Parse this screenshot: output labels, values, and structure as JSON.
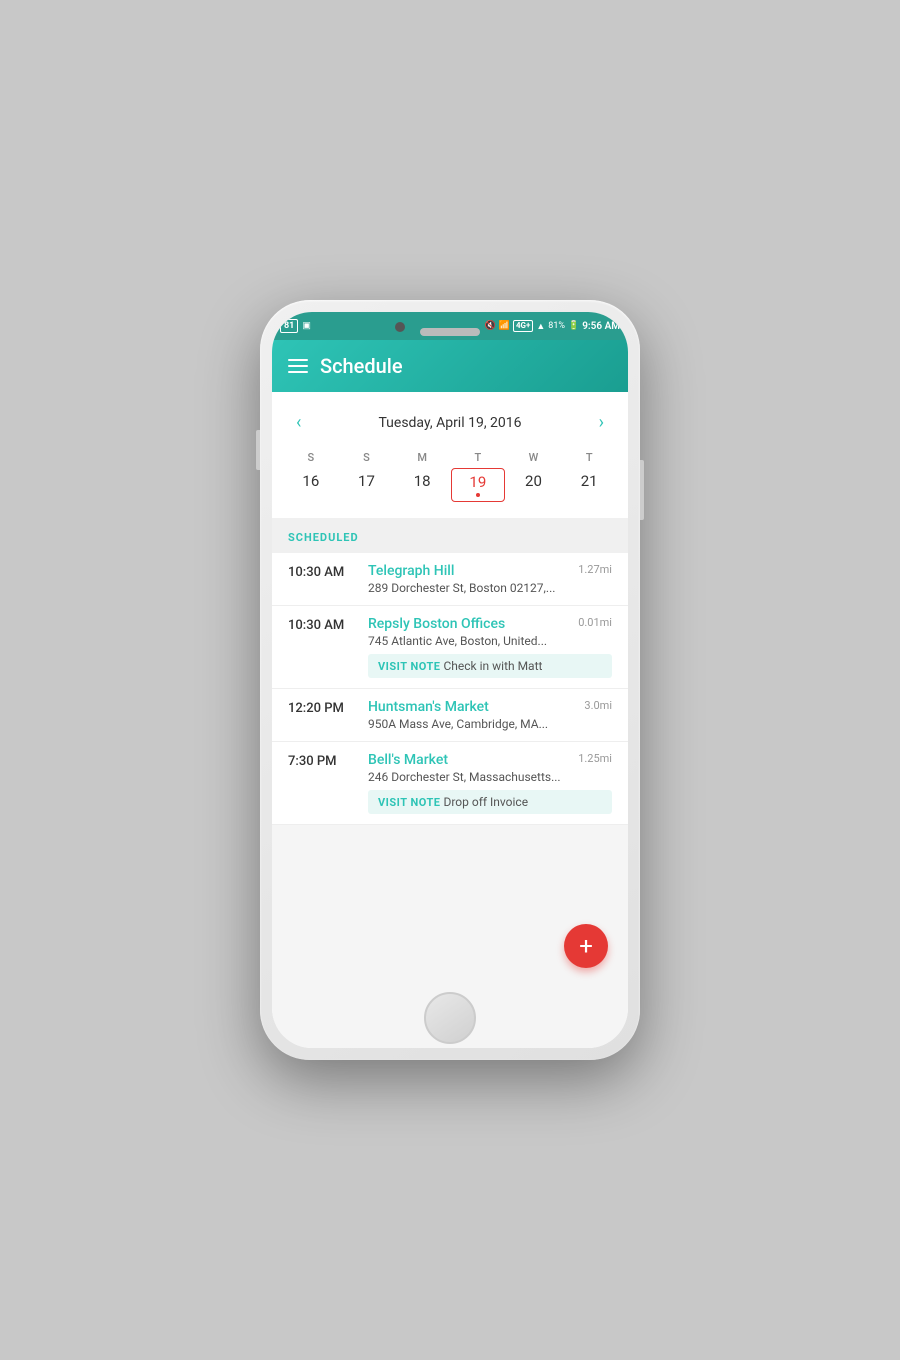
{
  "status_bar": {
    "badge1": "81",
    "time": "9:56 AM",
    "battery": "81%",
    "lte": "4G+"
  },
  "app_bar": {
    "title": "Schedule"
  },
  "calendar": {
    "nav_date": "Tuesday, April 19, 2016",
    "day_headers": [
      "S",
      "S",
      "M",
      "T",
      "W",
      "T"
    ],
    "days": [
      {
        "num": "16",
        "active": false
      },
      {
        "num": "17",
        "active": false
      },
      {
        "num": "18",
        "active": false
      },
      {
        "num": "19",
        "active": true,
        "dot": true
      },
      {
        "num": "20",
        "active": false
      },
      {
        "num": "21",
        "active": false
      }
    ]
  },
  "schedule": {
    "section_label": "SCHEDULED",
    "items": [
      {
        "time": "10:30 AM",
        "name": "Telegraph Hill",
        "distance": "1.27mi",
        "address": "289 Dorchester St, Boston 02127,...",
        "visit_note": null
      },
      {
        "time": "10:30 AM",
        "name": "Repsly Boston Offices",
        "distance": "0.01mi",
        "address": "745 Atlantic Ave, Boston, United...",
        "visit_note": "Check in with Matt"
      },
      {
        "time": "12:20 PM",
        "name": "Huntsman's Market",
        "distance": "3.0mi",
        "address": "950A Mass Ave, Cambridge, MA...",
        "visit_note": null
      },
      {
        "time": "7:30 PM",
        "name": "Bell's Market",
        "distance": "1.25mi",
        "address": "246 Dorchester St, Massachusetts...",
        "visit_note": "Drop off Invoice"
      }
    ],
    "fab_label": "+"
  }
}
